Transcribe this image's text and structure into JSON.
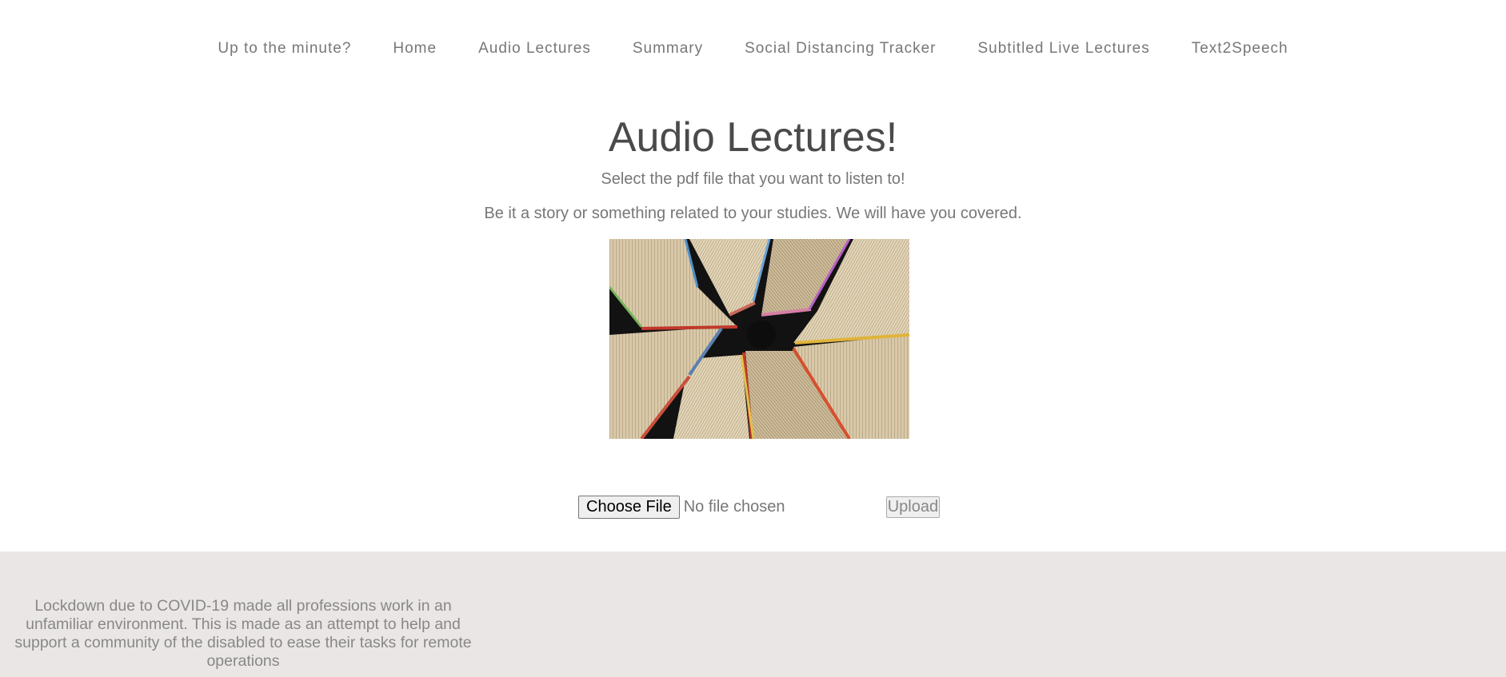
{
  "nav": {
    "items": [
      {
        "label": "Up to the minute?"
      },
      {
        "label": "Home"
      },
      {
        "label": "Audio Lectures"
      },
      {
        "label": "Summary"
      },
      {
        "label": "Social Distancing Tracker"
      },
      {
        "label": "Subtitled Live Lectures"
      },
      {
        "label": "Text2Speech"
      }
    ]
  },
  "main": {
    "title": "Audio Lectures!",
    "subtitle": "Select the pdf file that you want to listen to!",
    "description": "Be it a story or something related to your studies. We will have you covered.",
    "image_subject": "open books fanned in a circle"
  },
  "upload": {
    "choose_label": "Choose File",
    "file_status": "No file chosen",
    "upload_label": "Upload"
  },
  "footer": {
    "text": "Lockdown due to COVID-19 made all professions work in an unfamiliar environment. This is made as an attempt to help and support a community of the disabled to ease their tasks for remote operations"
  },
  "colors": {
    "nav_text": "#777777",
    "title": "#4a4a4a",
    "body_text": "#777777",
    "footer_bg": "#eae6e5",
    "footer_text": "#888888"
  }
}
